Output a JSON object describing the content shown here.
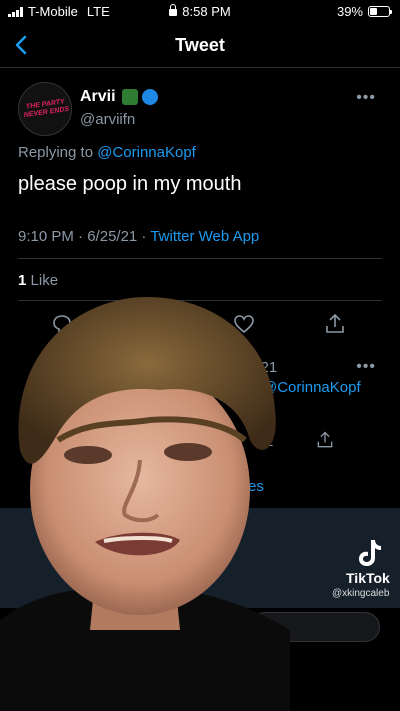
{
  "status_bar": {
    "carrier": "T-Mobile",
    "network": "LTE",
    "time": "8:58 PM",
    "battery": "39%",
    "battery_level": 0.39
  },
  "nav": {
    "title": "Tweet",
    "back_icon": "chevron-left-icon"
  },
  "tweet": {
    "display_name": "Arvii",
    "handle": "@arviifn",
    "avatar_text": "THE PARTY NEVER ENDS",
    "emoji_icons": [
      "money-bag-emoji",
      "globe-emoji"
    ],
    "replying_label": "Replying to",
    "replying_to": "@CorinnaKopf",
    "text": "please poop in my mouth",
    "time": "9:10 PM",
    "date": "6/25/21",
    "source": "Twitter Web App",
    "likes_count": "1",
    "likes_label": "Like",
    "more_icon": "ellipsis-icon",
    "actions": [
      "reply-icon",
      "retweet-icon",
      "like-icon",
      "share-icon"
    ]
  },
  "reply_tweet": {
    "date_fragment": "6/21",
    "mention": "@CorinnaKopf",
    "count_fragment": "1",
    "show_more_fragment": "es"
  },
  "overlay": {
    "brand": "TikTok",
    "username": "@xkingcaleb"
  },
  "colors": {
    "accent": "#1d9bf0",
    "secondary_text": "#8b98a5",
    "background": "#000000",
    "divider": "#2f3336"
  }
}
